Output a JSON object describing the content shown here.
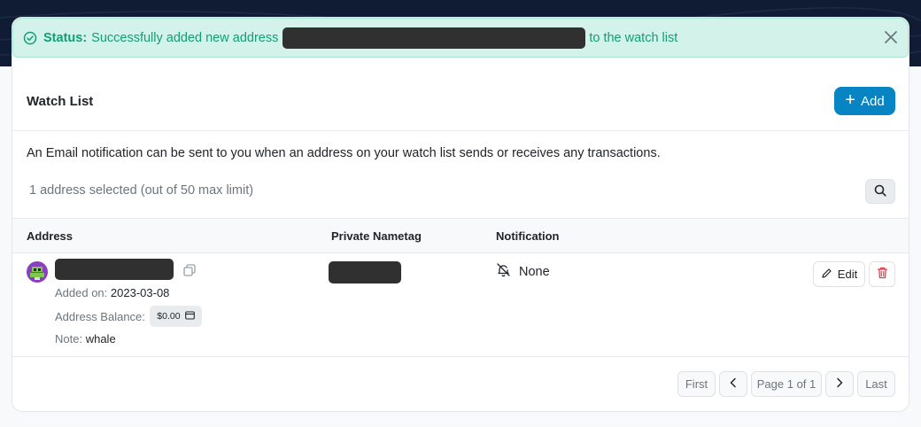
{
  "alert": {
    "status_label": "Status:",
    "message_before": "Successfully added new address",
    "message_after": "to the watch list"
  },
  "page": {
    "title": "Watch List",
    "add_label": "Add",
    "info_text": "An Email notification can be sent to you when an address on your watch list sends or receives any transactions.",
    "selected_text": "1 address selected (out of 50 max limit)"
  },
  "table": {
    "headers": [
      "Address",
      "Private Nametag",
      "Notification"
    ],
    "rows": [
      {
        "added_label": "Added on:",
        "added_on": "2023-03-08",
        "balance_label": "Address Balance:",
        "balance": "$0.00",
        "note_label": "Note:",
        "note": "whale",
        "notification": "None",
        "edit_label": "Edit"
      }
    ]
  },
  "pagination": {
    "first": "First",
    "page": "Page 1 of 1",
    "last": "Last"
  },
  "colors": {
    "accent": "#0784c3",
    "success": "#0f9f73",
    "danger": "#dc3545"
  }
}
